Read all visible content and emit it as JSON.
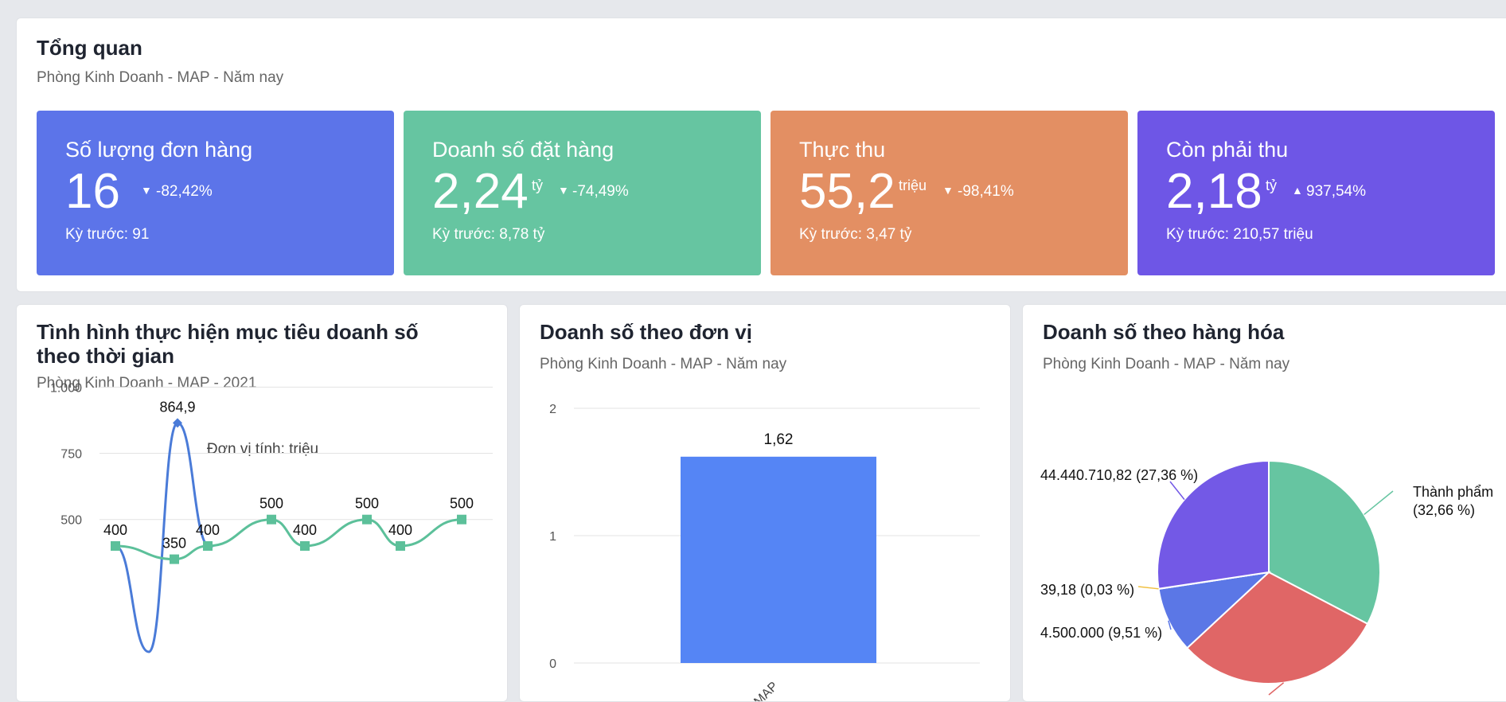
{
  "overview": {
    "title": "Tổng quan",
    "subtitle": "Phòng Kinh Doanh - MAP - Năm nay",
    "kpis": [
      {
        "label": "Số lượng đơn hàng",
        "value": "16",
        "unit": "",
        "direction": "down",
        "change": "-82,42%",
        "previous": "Kỳ trước: 91",
        "color": "#5c74e9"
      },
      {
        "label": "Doanh số đặt hàng",
        "value": "2,24",
        "unit": "tỷ",
        "direction": "down",
        "change": "-74,49%",
        "previous": "Kỳ trước: 8,78 tỷ",
        "color": "#66c5a1"
      },
      {
        "label": "Thực thu",
        "value": "55,2",
        "unit": "triệu",
        "direction": "down",
        "change": "-98,41%",
        "previous": "Kỳ trước: 3,47 tỷ",
        "color": "#e38f63"
      },
      {
        "label": "Còn phải thu",
        "value": "2,18",
        "unit": "tỷ",
        "direction": "up",
        "change": "937,54%",
        "previous": "Kỳ trước: 210,57 triệu",
        "color": "#6e56e6"
      }
    ],
    "icons": {
      "down": "caret-down-icon",
      "up": "caret-up-icon"
    }
  },
  "target_chart": {
    "title_line1": "Tình hình thực hiện mục tiêu doanh số",
    "title_line2": "theo thời gian",
    "subtitle": "Phòng Kinh Doanh - MAP - 2021"
  },
  "unit_chart": {
    "title": "Doanh số theo đơn vị",
    "subtitle": "Phòng Kinh Doanh - MAP - Năm nay"
  },
  "product_chart": {
    "title": "Doanh số theo hàng hóa",
    "subtitle": "Phòng Kinh Doanh - MAP - Năm nay"
  },
  "chart_data": [
    {
      "type": "line",
      "title": "Đơn vị tính: triệu",
      "ylim": [
        0,
        1000
      ],
      "yticks": [
        500,
        750,
        1000
      ],
      "ytick_labels": [
        "500",
        "750",
        "1.000"
      ],
      "grid": true,
      "series": [
        {
          "color": "#4a7bd8",
          "marker": "diamond",
          "values": [
            400,
            0,
            864.9,
            400
          ]
        },
        {
          "color": "#5cc09a",
          "marker": "square",
          "values": [
            400,
            350,
            400,
            500,
            400,
            500,
            400,
            500
          ]
        }
      ],
      "labels": [
        {
          "text": "400",
          "series": 0,
          "index": 0
        },
        {
          "text": "864,9",
          "series": 0,
          "index": 2
        },
        {
          "text": "350",
          "series": 1,
          "index": 1
        },
        {
          "text": "400",
          "series": 1,
          "index": 2
        },
        {
          "text": "500",
          "series": 1,
          "index": 3
        },
        {
          "text": "400",
          "series": 1,
          "index": 4
        },
        {
          "text": "500",
          "series": 1,
          "index": 5
        },
        {
          "text": "400",
          "series": 1,
          "index": 6
        },
        {
          "text": "500",
          "series": 1,
          "index": 7
        }
      ]
    },
    {
      "type": "bar",
      "categories": [
        "MAP"
      ],
      "values": [
        1.62
      ],
      "value_labels": [
        "1,62"
      ],
      "ylim": [
        0,
        2
      ],
      "yticks": [
        0,
        1,
        2
      ],
      "color": "#5585f5",
      "grid": true
    },
    {
      "type": "pie",
      "slices": [
        {
          "label": "Thành phẩm",
          "percent_label": "(32,66 %)",
          "value": 32.66,
          "color": "#66c5a1"
        },
        {
          "label": "",
          "percent_label": "",
          "value": 30.44,
          "color": "#e06666"
        },
        {
          "label": "4.500.000 (9,51 %)",
          "percent_label": "",
          "value": 9.51,
          "color": "#5b77e6"
        },
        {
          "label": "39,18 (0,03 %)",
          "percent_label": "",
          "value": 0.03,
          "color": "#f0c040"
        },
        {
          "label": "44.440.710,82 (27,36 %)",
          "percent_label": "",
          "value": 27.36,
          "color": "#7359e6"
        }
      ]
    }
  ]
}
